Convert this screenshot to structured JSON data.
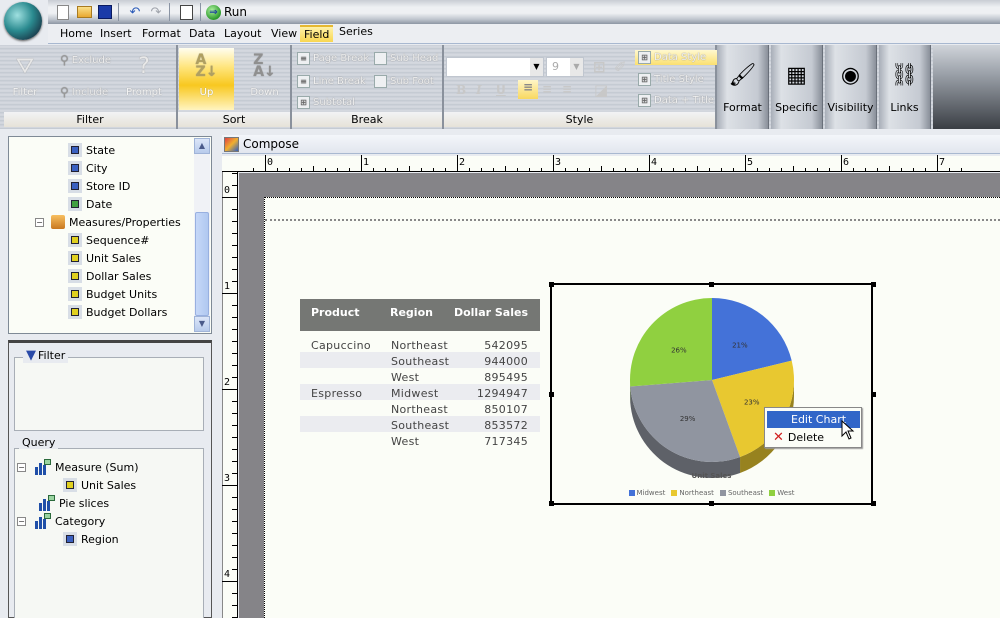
{
  "quick_access": {
    "new": "new-document",
    "open": "open-folder",
    "save": "save-disk",
    "undo": "undo",
    "redo": "redo",
    "preview": "print-preview",
    "run_label": "Run"
  },
  "menu": {
    "items": [
      "Home",
      "Insert",
      "Format",
      "Data",
      "Layout",
      "View",
      "Field",
      "Series"
    ],
    "active": "Field"
  },
  "ribbon": {
    "filter_group": {
      "label": "Filter",
      "filter": "Filter",
      "exclude": "Exclude",
      "include": "Include",
      "prompt": "Prompt"
    },
    "sort_group": {
      "label": "Sort",
      "up": "Up",
      "down": "Down"
    },
    "break_group": {
      "label": "Break",
      "page_break": "Page Break",
      "sub_head": "Sub Head",
      "line_break": "Line Break",
      "sub_foot": "Sub Foot",
      "subtotal": "Subtotal"
    },
    "style_group": {
      "label": "Style",
      "font_value": "",
      "size_value": "9",
      "bold": "B",
      "italic": "I",
      "underline": "U",
      "data_style": "Data Style",
      "title_style": "Title Style",
      "data_title": "Data + Title"
    },
    "format": "Format",
    "specific": "Specific",
    "visibility": "Visibility",
    "links": "Links"
  },
  "field_tree": {
    "items": [
      {
        "label": "State",
        "type": "dimension"
      },
      {
        "label": "City",
        "type": "dimension"
      },
      {
        "label": "Store ID",
        "type": "dimension"
      },
      {
        "label": "Date",
        "type": "date"
      },
      {
        "label": "Measures/Properties",
        "type": "folder"
      },
      {
        "label": "Sequence#",
        "type": "measure"
      },
      {
        "label": "Unit Sales",
        "type": "measure"
      },
      {
        "label": "Dollar Sales",
        "type": "measure"
      },
      {
        "label": "Budget Units",
        "type": "measure"
      },
      {
        "label": "Budget Dollars",
        "type": "measure"
      }
    ]
  },
  "filter_panel": {
    "label": "Filter"
  },
  "query_panel": {
    "label": "Query",
    "items": [
      {
        "label": "Measure (Sum)"
      },
      {
        "label": "Unit Sales"
      },
      {
        "label": "Pie slices"
      },
      {
        "label": "Category"
      },
      {
        "label": "Region"
      }
    ]
  },
  "compose": {
    "title": "Compose",
    "h_ruler": [
      "0",
      "1",
      "2",
      "3",
      "4",
      "5",
      "6",
      "7"
    ],
    "v_ruler": [
      "0",
      "1",
      "2",
      "3",
      "4"
    ]
  },
  "report_table": {
    "headers": [
      "Product",
      "Region",
      "Dollar Sales"
    ],
    "rows": [
      {
        "product": "Capuccino",
        "region": "Northeast",
        "sales": "542095"
      },
      {
        "product": "",
        "region": "Southeast",
        "sales": "944000"
      },
      {
        "product": "",
        "region": "West",
        "sales": "895495"
      },
      {
        "product": "Espresso",
        "region": "Midwest",
        "sales": "1294947"
      },
      {
        "product": "",
        "region": "Northeast",
        "sales": "850107"
      },
      {
        "product": "",
        "region": "Southeast",
        "sales": "853572"
      },
      {
        "product": "",
        "region": "West",
        "sales": "717345"
      }
    ]
  },
  "chart_data": {
    "type": "pie",
    "title": "Unit Sales",
    "categories": [
      "Midwest",
      "Northeast",
      "Southeast",
      "West"
    ],
    "values": [
      21,
      23,
      29,
      26
    ],
    "labels": [
      "21%",
      "23%",
      "29%",
      "26%"
    ],
    "colors": [
      "#4472d8",
      "#e8c830",
      "#9095a0",
      "#90d040"
    ],
    "legend": "bottom"
  },
  "context_menu": {
    "items": [
      {
        "label": "Edit Chart",
        "highlighted": true
      },
      {
        "label": "Delete",
        "highlighted": false
      }
    ]
  }
}
